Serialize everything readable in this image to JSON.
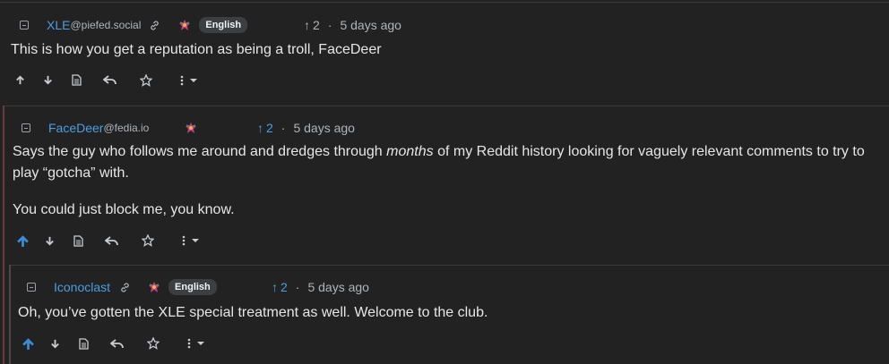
{
  "comments": [
    {
      "author": "XLE",
      "instance": "@piefed.social",
      "language": "English",
      "score_arrow": "↑",
      "score": "2",
      "separator": "·",
      "age": "5 days ago",
      "paragraphs": [
        "This is how you get a reputation as being a troll, FaceDeer"
      ],
      "upvoted": false
    },
    {
      "author": "FaceDeer",
      "instance": "@fedia.io",
      "language": "",
      "score_arrow": "↑",
      "score": "2",
      "separator": "·",
      "age": "5 days ago",
      "paragraph1_before": "Says the guy who follows me around and dredges through ",
      "paragraph1_em": "months",
      "paragraph1_after": " of my Reddit history looking for vaguely relevant comments to try to play “gotcha” with.",
      "paragraph2": "You could just block me, you know.",
      "upvoted": true
    },
    {
      "author": "Iconoclast",
      "instance": "",
      "language": "English",
      "score_arrow": "↑",
      "score": "2",
      "separator": "·",
      "age": "5 days ago",
      "paragraphs": [
        "Oh, you’ve gotten the XLE special treatment as well. Welcome to the club."
      ],
      "upvoted": true
    }
  ],
  "icons": [
    "collapse-icon",
    "link-icon",
    "flair-icon",
    "upvote-icon",
    "downvote-icon",
    "view-source-icon",
    "reply-icon",
    "bookmark-star-icon",
    "more-options-icon"
  ],
  "colors": {
    "background": "#222222",
    "author": "#4a9fe0",
    "upvoted": "#3d8bd4",
    "border_lvl1": "#6b3a3a",
    "border_lvl2": "#4a4a4a"
  }
}
